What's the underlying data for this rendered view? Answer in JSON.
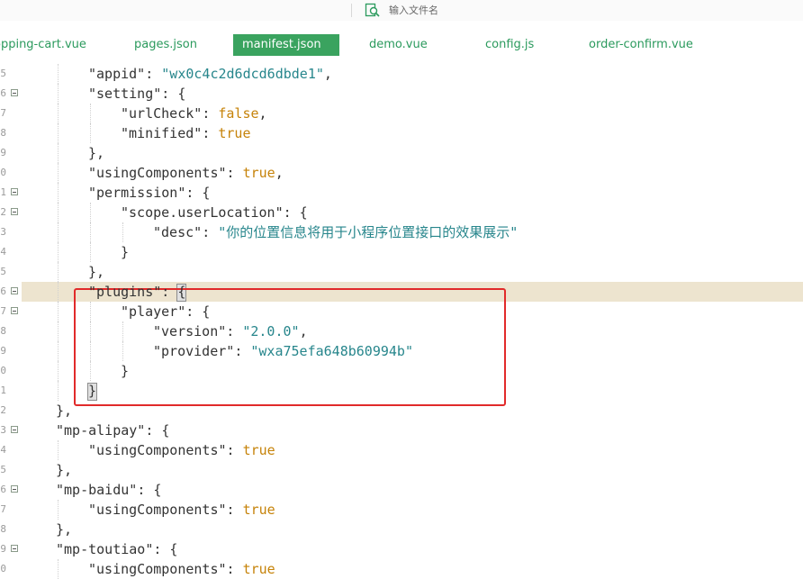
{
  "search": {
    "placeholder": "输入文件名"
  },
  "tabs": [
    {
      "label": "opping-cart.vue"
    },
    {
      "label": "pages.json"
    },
    {
      "label": "manifest.json",
      "active": true
    },
    {
      "label": "demo.vue"
    },
    {
      "label": "config.js"
    },
    {
      "label": "order-confirm.vue"
    }
  ],
  "editor": {
    "lines": [
      {
        "num": "5",
        "fold": false,
        "tokens": [
          [
            "k",
            "\"appid\""
          ],
          [
            "p",
            ": "
          ],
          [
            "s",
            "\"wx0c4c2d6dcd6dbde1\""
          ],
          [
            "p",
            ","
          ]
        ]
      },
      {
        "num": "6",
        "fold": true,
        "tokens": [
          [
            "k",
            "\"setting\""
          ],
          [
            "p",
            ": {"
          ]
        ]
      },
      {
        "num": "7",
        "fold": false,
        "tokens": [
          [
            "k",
            "\"urlCheck\""
          ],
          [
            "p",
            ": "
          ],
          [
            "b",
            "false"
          ],
          [
            "p",
            ","
          ]
        ]
      },
      {
        "num": "8",
        "fold": false,
        "tokens": [
          [
            "k",
            "\"minified\""
          ],
          [
            "p",
            ": "
          ],
          [
            "b",
            "true"
          ]
        ]
      },
      {
        "num": "9",
        "fold": false,
        "tokens": [
          [
            "p",
            "},"
          ]
        ]
      },
      {
        "num": "0",
        "fold": false,
        "tokens": [
          [
            "k",
            "\"usingComponents\""
          ],
          [
            "p",
            ": "
          ],
          [
            "b",
            "true"
          ],
          [
            "p",
            ","
          ]
        ]
      },
      {
        "num": "1",
        "fold": true,
        "tokens": [
          [
            "k",
            "\"permission\""
          ],
          [
            "p",
            ": {"
          ]
        ]
      },
      {
        "num": "2",
        "fold": true,
        "tokens": [
          [
            "k",
            "\"scope.userLocation\""
          ],
          [
            "p",
            ": {"
          ]
        ]
      },
      {
        "num": "3",
        "fold": false,
        "tokens": [
          [
            "k",
            "\"desc\""
          ],
          [
            "p",
            ": "
          ],
          [
            "s",
            "\"你的位置信息将用于小程序位置接口的效果展示\""
          ]
        ]
      },
      {
        "num": "4",
        "fold": false,
        "tokens": [
          [
            "p",
            "}"
          ]
        ]
      },
      {
        "num": "5",
        "fold": false,
        "tokens": [
          [
            "p",
            "},"
          ]
        ]
      },
      {
        "num": "6",
        "fold": true,
        "tokens": [
          [
            "k",
            "\"plugins\""
          ],
          [
            "p",
            ": {"
          ]
        ]
      },
      {
        "num": "7",
        "fold": true,
        "tokens": [
          [
            "k",
            "\"player\""
          ],
          [
            "p",
            ": {"
          ]
        ]
      },
      {
        "num": "8",
        "fold": false,
        "tokens": [
          [
            "k",
            "\"version\""
          ],
          [
            "p",
            ": "
          ],
          [
            "s",
            "\"2.0.0\""
          ],
          [
            "p",
            ","
          ]
        ]
      },
      {
        "num": "9",
        "fold": false,
        "tokens": [
          [
            "k",
            "\"provider\""
          ],
          [
            "p",
            ": "
          ],
          [
            "s",
            "\"wxa75efa648b60994b\""
          ]
        ]
      },
      {
        "num": "0",
        "fold": false,
        "tokens": [
          [
            "p",
            "}"
          ]
        ]
      },
      {
        "num": "1",
        "fold": false,
        "tokens": [
          [
            "p",
            "}"
          ]
        ]
      },
      {
        "num": "2",
        "fold": false,
        "tokens": [
          [
            "p",
            "},"
          ]
        ]
      },
      {
        "num": "3",
        "fold": true,
        "tokens": [
          [
            "k",
            "\"mp-alipay\""
          ],
          [
            "p",
            ": {"
          ]
        ]
      },
      {
        "num": "4",
        "fold": false,
        "tokens": [
          [
            "k",
            "\"usingComponents\""
          ],
          [
            "p",
            ": "
          ],
          [
            "b",
            "true"
          ]
        ]
      },
      {
        "num": "5",
        "fold": false,
        "tokens": [
          [
            "p",
            "},"
          ]
        ]
      },
      {
        "num": "6",
        "fold": true,
        "tokens": [
          [
            "k",
            "\"mp-baidu\""
          ],
          [
            "p",
            ": {"
          ]
        ]
      },
      {
        "num": "7",
        "fold": false,
        "tokens": [
          [
            "k",
            "\"usingComponents\""
          ],
          [
            "p",
            ": "
          ],
          [
            "b",
            "true"
          ]
        ]
      },
      {
        "num": "8",
        "fold": false,
        "tokens": [
          [
            "p",
            "},"
          ]
        ]
      },
      {
        "num": "9",
        "fold": true,
        "tokens": [
          [
            "k",
            "\"mp-toutiao\""
          ],
          [
            "p",
            ": {"
          ]
        ]
      },
      {
        "num": "0",
        "fold": false,
        "tokens": [
          [
            "k",
            "\"usingComponents\""
          ],
          [
            "p",
            ": "
          ],
          [
            "b",
            "true"
          ]
        ]
      }
    ]
  }
}
